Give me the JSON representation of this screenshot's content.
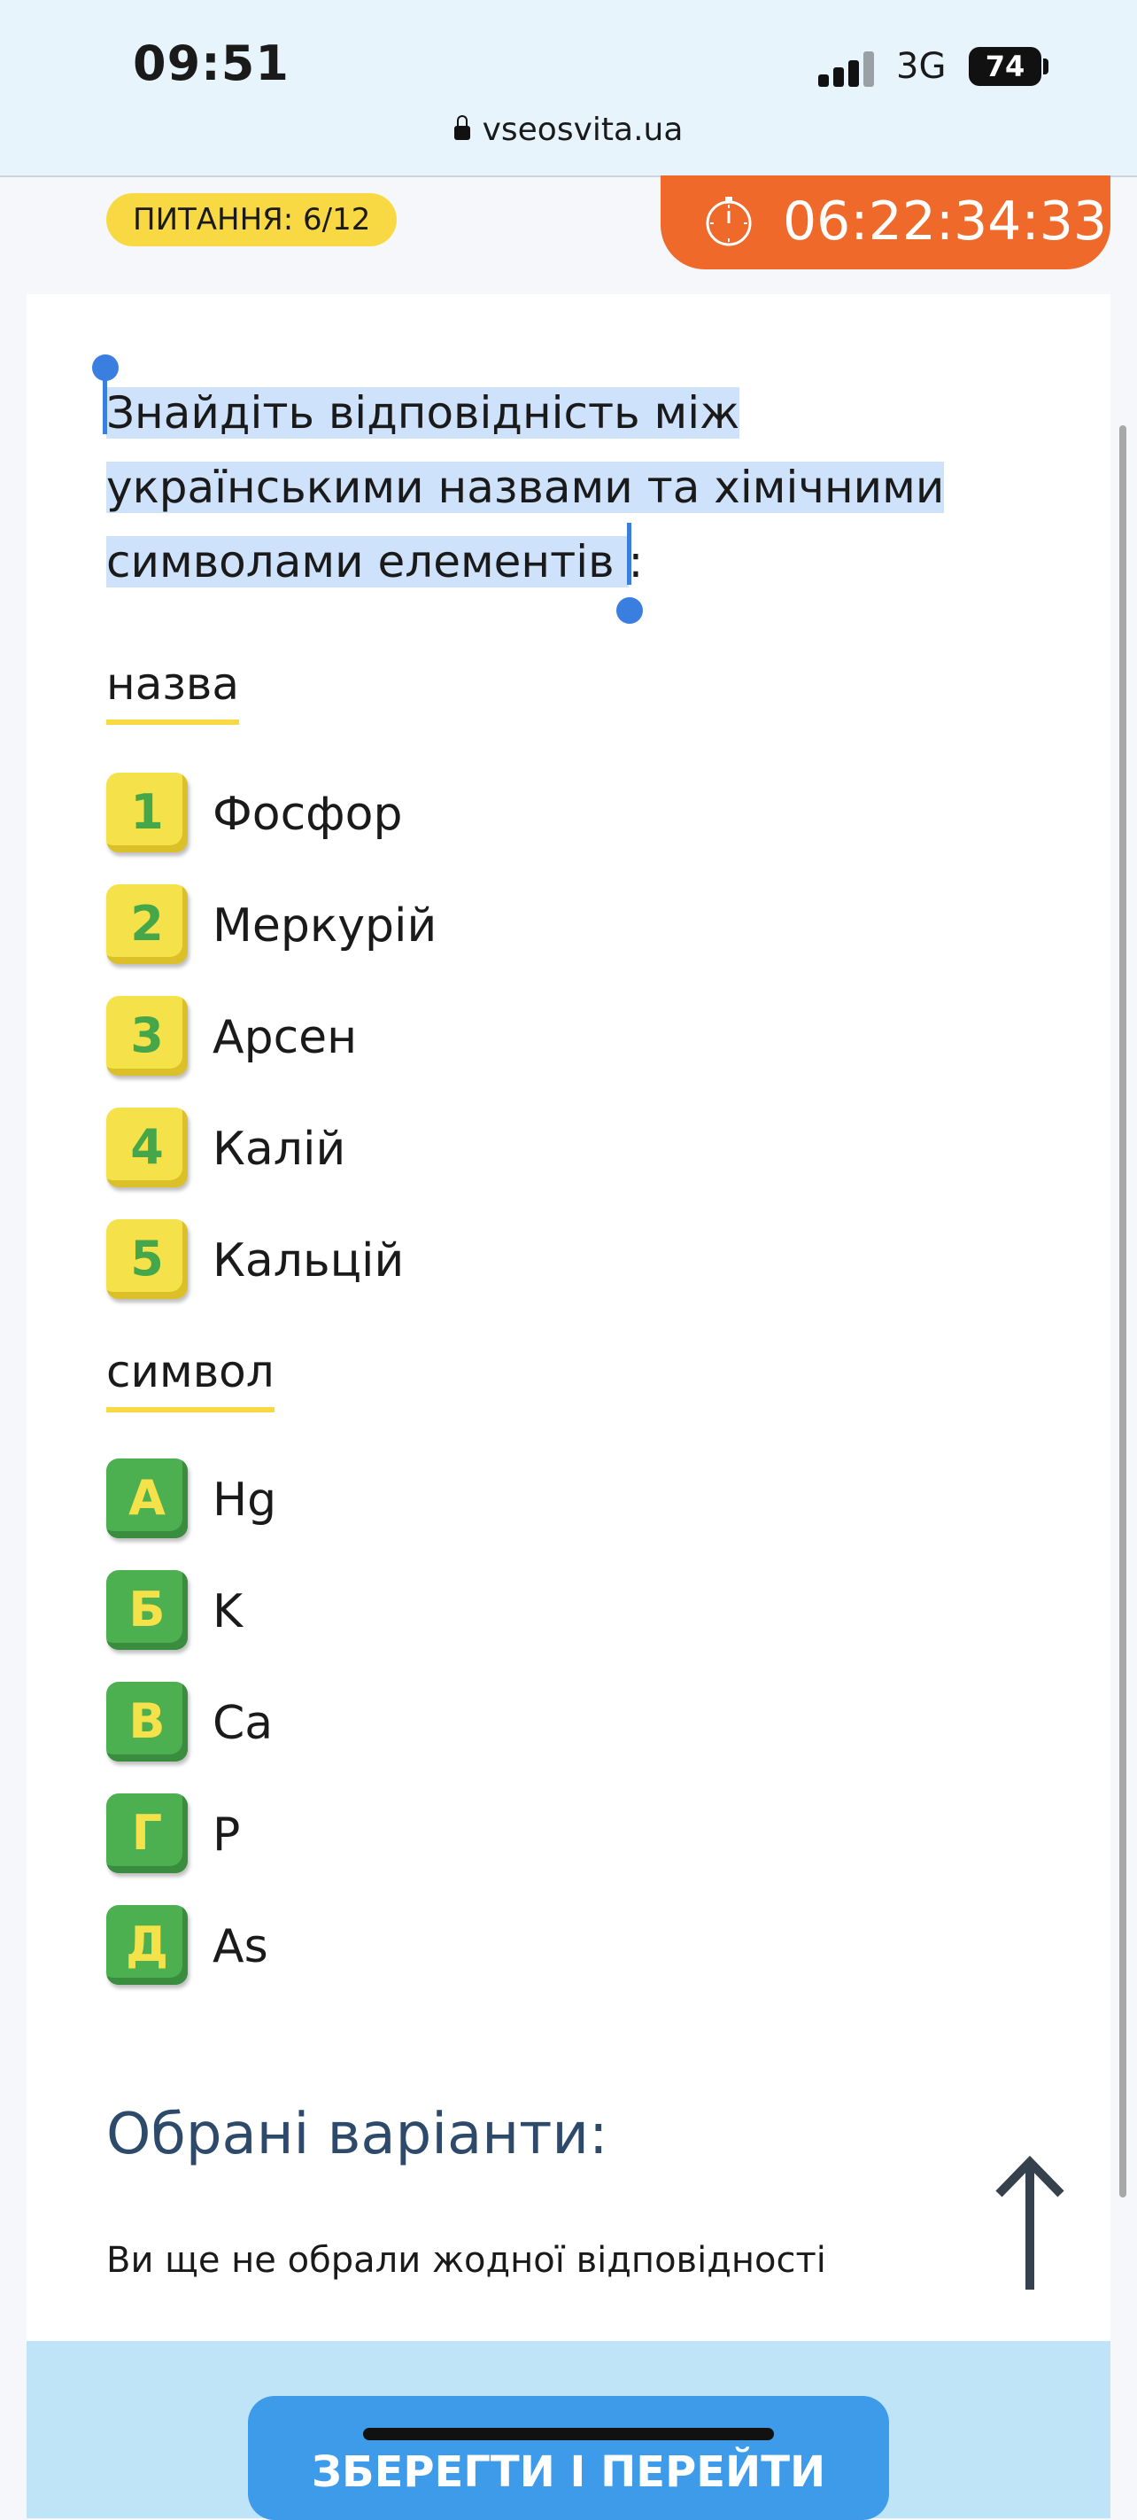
{
  "status_bar": {
    "time": "09:51",
    "network": "3G",
    "battery": "74"
  },
  "browser": {
    "url": "vseosvita.ua"
  },
  "quiz": {
    "counter_label": "ПИТАННЯ: 6/12",
    "timer": "06:22:34:33",
    "question_lines": [
      "Знайдіть відповідність між",
      "українськими назвами та хімічними",
      "символами елементів "
    ],
    "question_tail": ":",
    "left_title": "назва",
    "left_items": [
      {
        "key": "1",
        "text": "Фосфор"
      },
      {
        "key": "2",
        "text": "Меркурій"
      },
      {
        "key": "3",
        "text": "Арсен"
      },
      {
        "key": "4",
        "text": "Калій"
      },
      {
        "key": "5",
        "text": "Кальцій"
      }
    ],
    "right_title": "символ",
    "right_items": [
      {
        "key": "А",
        "text": "Hg"
      },
      {
        "key": "Б",
        "text": "K"
      },
      {
        "key": "В",
        "text": "Ca"
      },
      {
        "key": "Г",
        "text": "P"
      },
      {
        "key": "Д",
        "text": "As"
      }
    ],
    "chosen_title": "Обрані варіанти:",
    "chosen_empty": "Ви ще не обрали жодної відповідності",
    "save_button": "ЗБЕРЕГТИ І ПЕРЕЙТИ ДАЛІ"
  },
  "colors": {
    "accent_yellow": "#f8d944",
    "timer_orange": "#ef6a2a",
    "badge_green": "#4caf50",
    "button_blue": "#3d9be9",
    "selection": "#cfe2fb"
  },
  "icons": [
    "lock-icon",
    "stopwatch-icon",
    "scroll-up-arrow-icon"
  ]
}
